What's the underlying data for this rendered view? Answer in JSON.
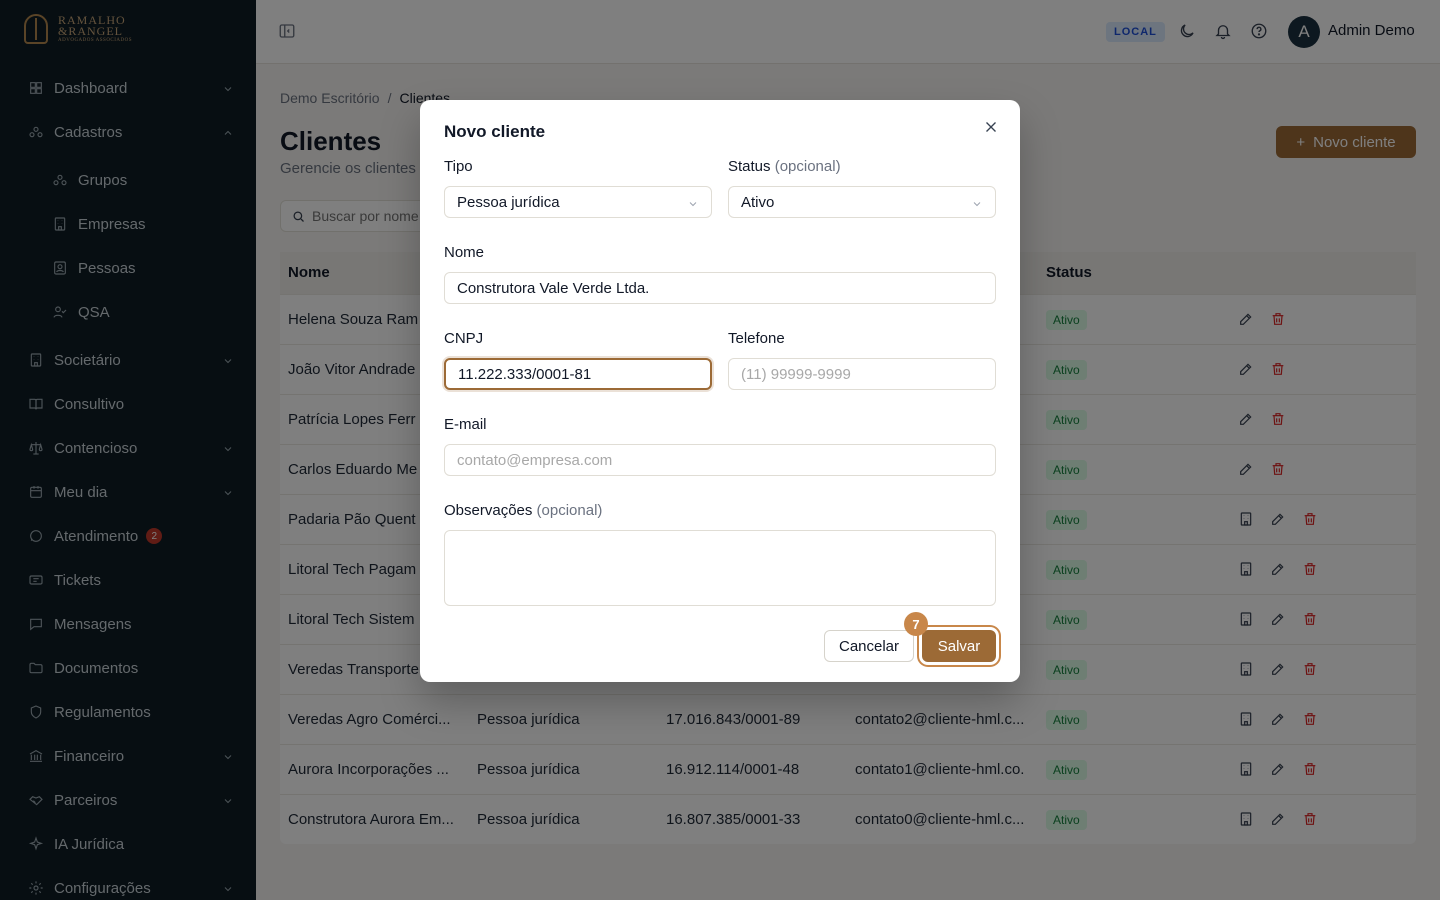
{
  "brand": {
    "logo_line1": "RAMALHO",
    "logo_line2": "&RANGEL",
    "logo_tagline": "ADVOGADOS ASSOCIADOS"
  },
  "sidebar": {
    "items": [
      {
        "label": "Dashboard",
        "icon": "dashboard-icon",
        "chevron": "down"
      },
      {
        "label": "Cadastros",
        "icon": "cadastros-icon",
        "chevron": "up"
      },
      {
        "label": "Grupos",
        "icon": "grupos-icon",
        "sub": true
      },
      {
        "label": "Empresas",
        "icon": "building-icon",
        "sub": true
      },
      {
        "label": "Pessoas",
        "icon": "contact-icon",
        "sub": true
      },
      {
        "label": "QSA",
        "icon": "user-check-icon",
        "sub": true
      },
      {
        "label": "Societário",
        "icon": "building-icon",
        "chevron": "down"
      },
      {
        "label": "Consultivo",
        "icon": "book-icon"
      },
      {
        "label": "Contencioso",
        "icon": "scale-icon",
        "chevron": "down"
      },
      {
        "label": "Meu dia",
        "icon": "calendar-icon",
        "chevron": "down"
      },
      {
        "label": "Atendimento",
        "icon": "chat-icon",
        "badge": "2"
      },
      {
        "label": "Tickets",
        "icon": "ticket-icon"
      },
      {
        "label": "Mensagens",
        "icon": "message-icon"
      },
      {
        "label": "Documentos",
        "icon": "folder-icon"
      },
      {
        "label": "Regulamentos",
        "icon": "shield-icon"
      },
      {
        "label": "Financeiro",
        "icon": "bank-icon",
        "chevron": "down"
      },
      {
        "label": "Parceiros",
        "icon": "handshake-icon",
        "chevron": "down"
      },
      {
        "label": "IA Jurídica",
        "icon": "sparkle-icon"
      },
      {
        "label": "Configurações",
        "icon": "gear-icon",
        "chevron": "down"
      }
    ]
  },
  "topbar": {
    "env": "LOCAL",
    "user_initial": "A",
    "user_name": "Admin Demo"
  },
  "page": {
    "breadcrumb_root": "Demo Escritório",
    "breadcrumb_sep": "/",
    "breadcrumb_current": "Clientes",
    "title": "Clientes",
    "subtitle": "Gerencie os clientes",
    "new_button": "Novo cliente",
    "search_placeholder": "Buscar por nome"
  },
  "table": {
    "headers": {
      "name": "Nome",
      "status": "Status"
    },
    "rows": [
      {
        "name": "Helena Souza Ram",
        "tipo": "",
        "doc": "",
        "email": "",
        "status": "Ativo",
        "company": false
      },
      {
        "name": "João Vitor Andrade",
        "tipo": "",
        "doc": "",
        "email": "",
        "status": "Ativo",
        "company": false
      },
      {
        "name": "Patrícia Lopes Ferr",
        "tipo": "",
        "doc": "",
        "email": "",
        "status": "Ativo",
        "company": false
      },
      {
        "name": "Carlos Eduardo Me",
        "tipo": "",
        "doc": "",
        "email": "",
        "status": "Ativo",
        "company": false
      },
      {
        "name": "Padaria Pão Quent",
        "tipo": "",
        "doc": "",
        "email": "",
        "status": "Ativo",
        "company": true
      },
      {
        "name": "Litoral Tech Pagam",
        "tipo": "",
        "doc": "",
        "email": "",
        "status": "Ativo",
        "company": true
      },
      {
        "name": "Litoral Tech Sistem",
        "tipo": "",
        "doc": "",
        "email": "",
        "status": "Ativo",
        "company": true
      },
      {
        "name": "Veredas Transporte",
        "tipo": "",
        "doc": "",
        "email": "",
        "status": "Ativo",
        "company": true
      },
      {
        "name": "Veredas Agro Comérci...",
        "tipo": "Pessoa jurídica",
        "doc": "17.016.843/0001-89",
        "email": "contato2@cliente-hml.c...",
        "status": "Ativo",
        "company": true
      },
      {
        "name": "Aurora Incorporações ...",
        "tipo": "Pessoa jurídica",
        "doc": "16.912.114/0001-48",
        "email": "contato1@cliente-hml.co...",
        "status": "Ativo",
        "company": true
      },
      {
        "name": "Construtora Aurora Em...",
        "tipo": "Pessoa jurídica",
        "doc": "16.807.385/0001-33",
        "email": "contato0@cliente-hml.c...",
        "status": "Ativo",
        "company": true
      }
    ]
  },
  "modal": {
    "title": "Novo cliente",
    "tipo_label": "Tipo",
    "tipo_value": "Pessoa jurídica",
    "status_label": "Status",
    "status_optional": "(opcional)",
    "status_value": "Ativo",
    "nome_label": "Nome",
    "nome_value": "Construtora Vale Verde Ltda.",
    "cnpj_label": "CNPJ",
    "cnpj_value": "11.222.333/0001-81",
    "telefone_label": "Telefone",
    "telefone_placeholder": "(11) 99999-9999",
    "email_label": "E-mail",
    "email_placeholder": "contato@empresa.com",
    "obs_label": "Observações",
    "obs_optional": "(opcional)",
    "cancel": "Cancelar",
    "save": "Salvar",
    "step": "7"
  },
  "colors": {
    "brand": "#9c6a36",
    "sidebar_bg": "#0f1c24",
    "status_green": "#15803d",
    "danger": "#dc2626"
  }
}
